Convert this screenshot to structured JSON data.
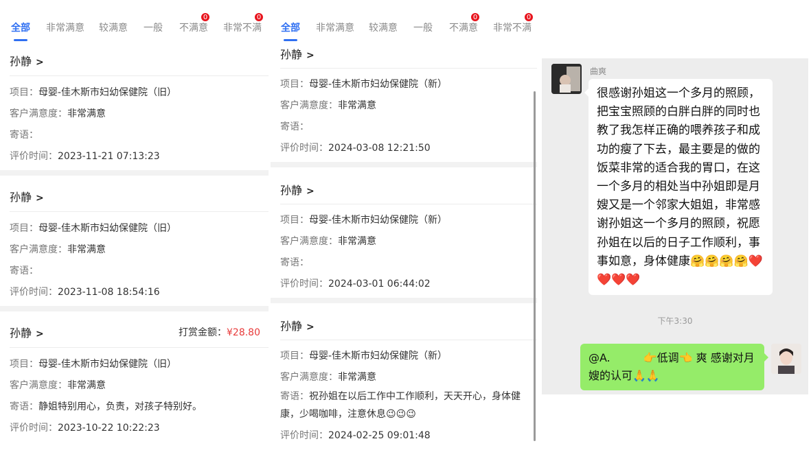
{
  "tabs": [
    {
      "label": "全部",
      "active": true
    },
    {
      "label": "非常满意"
    },
    {
      "label": "较满意"
    },
    {
      "label": "一般"
    },
    {
      "label": "不满意",
      "badge": "0"
    },
    {
      "label": "非常不满",
      "badge": "0"
    }
  ],
  "labels": {
    "project": "项目：",
    "satisfaction": "客户满意度：",
    "message": "寄语：",
    "time": "评价时间：",
    "reward": "打赏金额："
  },
  "panel1": {
    "cards": [
      {
        "name": "孙静",
        "project": "母婴-佳木斯市妇幼保健院（旧）",
        "satisfaction": "非常满意",
        "message": "",
        "time": "2023-11-21 07:13:23"
      },
      {
        "name": "孙静",
        "project": "母婴-佳木斯市妇幼保健院（旧）",
        "satisfaction": "非常满意",
        "message": "",
        "time": "2023-11-08 18:54:16"
      },
      {
        "name": "孙静",
        "reward": "¥28.80",
        "project": "母婴-佳木斯市妇幼保健院（旧）",
        "satisfaction": "非常满意",
        "message": "静姐特别用心，负责，对孩子特别好。",
        "time": "2023-10-22 10:22:23"
      }
    ]
  },
  "panel2": {
    "cards": [
      {
        "name": "孙静",
        "project": "母婴-佳木斯市妇幼保健院（新）",
        "satisfaction": "非常满意",
        "message": "",
        "time": "2024-03-08 12:21:50"
      },
      {
        "name": "孙静",
        "project": "母婴-佳木斯市妇幼保健院（新）",
        "satisfaction": "非常满意",
        "message": "",
        "time": "2024-03-01 06:44:02"
      },
      {
        "name": "孙静",
        "project": "母婴-佳木斯市妇幼保健院（新）",
        "satisfaction": "非常满意",
        "message": "祝孙姐在以后工作中工作顺利，天天开心，身体健康，少喝咖啡，注意休息😉😉😉",
        "time": "2024-02-25 09:01:48"
      }
    ]
  },
  "chat": {
    "contact_name": "曲爽",
    "incoming_message": "很感谢孙姐这一个多月的照顾，把宝宝照顾的白胖白胖的同时也教了我怎样正确的喂养孩子和成功的瘦了下去，最主要是的做的饭菜非常的适合我的胃口，在这一个多月的相处当中孙姐即是月嫂又是一个邻家大姐姐，非常感谢孙姐这一个多月的照顾，祝愿孙姐在以后的日子工作顺利，事事如意，身体健康🤗🤗🤗🤗❤️❤️❤️❤️",
    "timestamp": "下午3:30",
    "outgoing_message": "@A.　　　👉低调👈 爽 感谢对月嫂的认可🙏🙏",
    "bubble_color": "#95ec69"
  },
  "colors": {
    "accent": "#2f6ff2",
    "badge": "#e8131c",
    "reward_amount": "#e83a3a"
  }
}
